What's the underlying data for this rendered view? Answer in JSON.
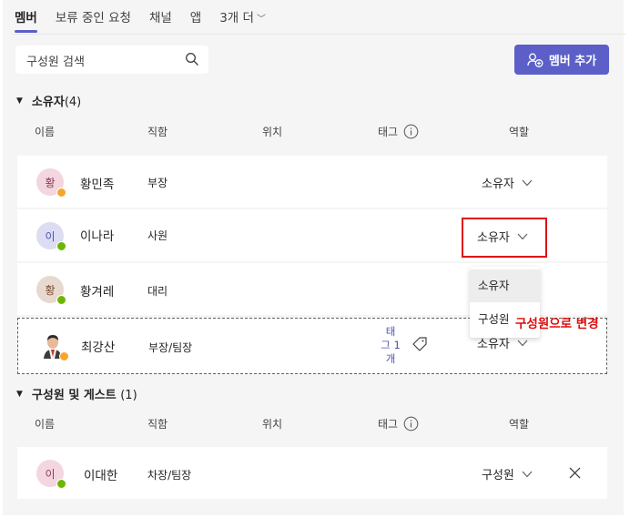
{
  "tabs": [
    {
      "label": "멤버",
      "active": true
    },
    {
      "label": "보류 중인 요청"
    },
    {
      "label": "채널"
    },
    {
      "label": "앱"
    },
    {
      "label": "3개 더"
    }
  ],
  "search": {
    "placeholder": "구성원 검색"
  },
  "add_member_label": "멤버 추가",
  "columns": {
    "name": "이름",
    "title": "직함",
    "location": "위치",
    "tags": "태그",
    "role": "역할"
  },
  "owners": {
    "heading": "소유자",
    "count": "(4)",
    "members": [
      {
        "initial": "황",
        "name": "황민족",
        "title": "부장",
        "role": "소유자",
        "status": "away"
      },
      {
        "initial": "이",
        "name": "이나라",
        "title": "사원",
        "role": "소유자",
        "status": "ok"
      },
      {
        "initial": "황",
        "name": "황겨레",
        "title": "대리",
        "role": "",
        "status": "ok"
      },
      {
        "initial": "",
        "name": "최강산",
        "title": "부장/팀장",
        "role": "소유자",
        "status": "away",
        "tag": "태그 1개"
      }
    ]
  },
  "members": {
    "heading": "구성원 및 게스트",
    "count": "(1)",
    "members": [
      {
        "initial": "이",
        "name": "이대한",
        "title": "차장/팀장",
        "role": "구성원",
        "status": "ok"
      }
    ]
  },
  "role_dropdown": {
    "options": [
      "소유자",
      "구성원"
    ]
  },
  "annotation": "구성원으로 변경",
  "tag_lines": [
    "태",
    "그 1",
    "개"
  ],
  "colors": {
    "accent": "#5b5fc7",
    "annotation": "#e00b0b",
    "away": "#f8a629",
    "available": "#6bb700"
  }
}
